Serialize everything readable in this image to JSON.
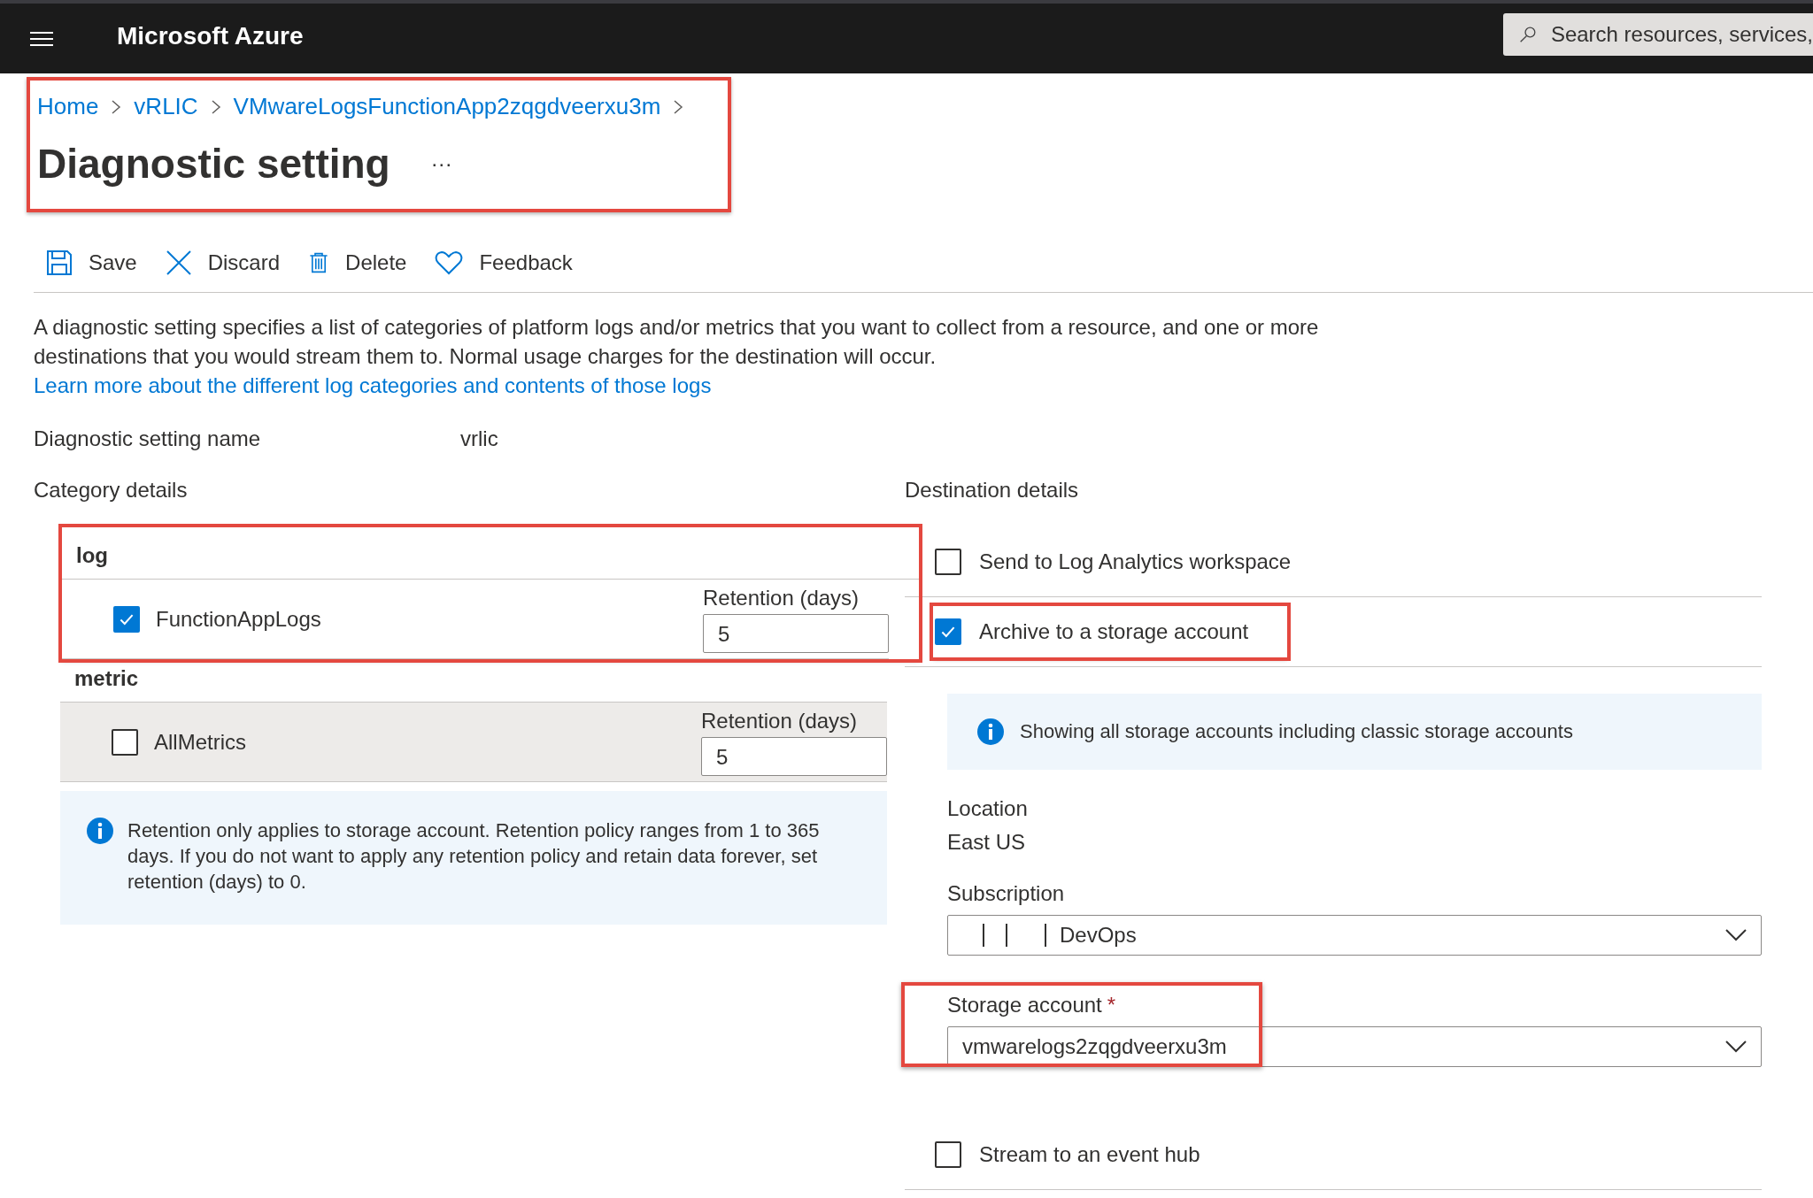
{
  "topbar": {
    "title": "Microsoft Azure",
    "search": {
      "placeholder": "Search resources, services,"
    }
  },
  "header": {
    "annotated": true,
    "breadcrumb": [
      {
        "label": "Home"
      },
      {
        "label": "vRLIC"
      },
      {
        "label": "VMwareLogsFunctionApp2zqgdveerxu3m"
      }
    ],
    "title": "Diagnostic setting",
    "more": "···"
  },
  "toolbar": [
    {
      "kind": "save",
      "label": "Save"
    },
    {
      "kind": "discard",
      "label": "Discard"
    },
    {
      "kind": "delete",
      "label": "Delete"
    },
    {
      "kind": "feedback",
      "label": "Feedback"
    }
  ],
  "description": {
    "text": "A diagnostic setting specifies a list of categories of platform logs and/or metrics that you want to collect from a resource, and one or more destinations that you would stream them to. Normal usage charges for the destination will occur. ",
    "link": "Learn more about the different log categories and contents of those logs"
  },
  "setting_name": {
    "label": "Diagnostic setting name",
    "value": "vrlic"
  },
  "category_details": {
    "heading": "Category details",
    "groups": [
      {
        "name": "log",
        "annotated": true,
        "items": [
          {
            "name": "FunctionAppLogs",
            "checked": true,
            "retention_label": "Retention (days)",
            "retention": "5"
          }
        ]
      },
      {
        "name": "metric",
        "items": [
          {
            "name": "AllMetrics",
            "checked": false,
            "hovered": true,
            "retention_label": "Retention (days)",
            "retention": "5"
          }
        ]
      }
    ],
    "note": "Retention only applies to storage account. Retention policy ranges from 1 to 365 days. If you do not want to apply any retention policy and retain data forever, set retention (days) to 0."
  },
  "destination_details": {
    "heading": "Destination details",
    "destinations": [
      {
        "label": "Send to Log Analytics workspace",
        "checked": false
      },
      {
        "label": "Archive to a storage account",
        "checked": true,
        "annotated": true,
        "info": "Showing all storage accounts including classic storage accounts",
        "fields": [
          {
            "kind": "text",
            "label": "Location",
            "value": "East US"
          },
          {
            "kind": "dropdown",
            "label": "Subscription",
            "value": "DevOps",
            "redacted": true
          },
          {
            "kind": "dropdown",
            "label": "Storage account",
            "required_mark": "*",
            "value": "vmwarelogs2zqgdveerxu3m",
            "annotated": true
          }
        ]
      },
      {
        "label": "Stream to an event hub",
        "checked": false
      }
    ]
  }
}
